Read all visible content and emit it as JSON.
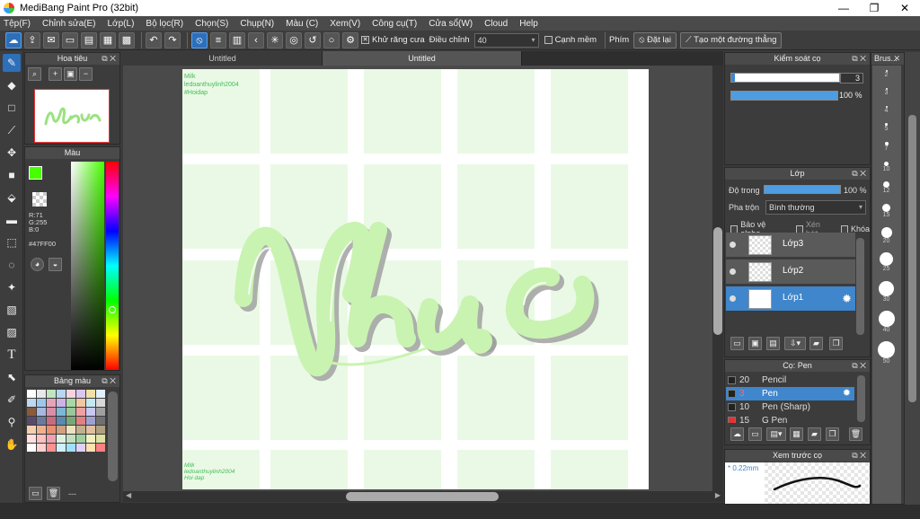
{
  "window": {
    "title": "MediBang Paint Pro (32bit)",
    "controls": [
      "—",
      "❐",
      "✕"
    ]
  },
  "menu": [
    "Tệp(F)",
    "Chỉnh sửa(E)",
    "Lớp(L)",
    "Bộ lọc(R)",
    "Chọn(S)",
    "Chụp(N)",
    "Màu (C)",
    "Xem(V)",
    "Công cụ(T)",
    "Cửa sổ(W)",
    "Cloud",
    "Help"
  ],
  "toolbar": {
    "antialias_label": "Khử răng cưa",
    "adjust_label": "Điều chỉnh",
    "adjust_value": "40",
    "edge_label": "Cạnh mềm",
    "key_label": "Phím",
    "reset_label": "Đặt lại",
    "line_label": "Tạo một đường thẳng"
  },
  "navigator": {
    "title": "Hoa tiêu"
  },
  "color": {
    "title": "Màu",
    "rgb": [
      "R:71",
      "G:255",
      "B:0"
    ],
    "hex": "#47FF00",
    "primary": "#47ff00",
    "secondary": "#ffffff"
  },
  "palette": {
    "title": "Bảng màu",
    "footer": "---"
  },
  "tabs": [
    "Untitled",
    "Untitled"
  ],
  "canvas": {
    "top_text": [
      "Milk",
      "ledoanthuylinh2004",
      "#Hoidap"
    ],
    "artwork": "Nhục",
    "bottom_text": [
      "Milk",
      "ledoanthuylinh2004",
      "Hoi dap"
    ],
    "art_color": "#c9f3b1",
    "shadow_color": "#9c9c9c"
  },
  "brush_control": {
    "title": "Kiểm soát cọ",
    "size": "3",
    "opacity": "100 %"
  },
  "layers": {
    "title": "Lớp",
    "opacity_label": "Độ trong",
    "opacity_value": "100 %",
    "blend_label": "Pha trộn",
    "blend_value": "Bình thường",
    "protect_alpha": "Bảo vệ alpha",
    "clipping": "Xén bớt",
    "lock": "Khóa",
    "items": [
      {
        "name": "Lớp3",
        "selected": false
      },
      {
        "name": "Lớp2",
        "selected": false
      },
      {
        "name": "Lớp1",
        "selected": true
      }
    ]
  },
  "brushes": {
    "title": "Cọ: Pen",
    "items": [
      {
        "size": "20",
        "name": "Pencil",
        "color": "#222222",
        "selected": false
      },
      {
        "size": "3",
        "name": "Pen",
        "color": "#222222",
        "selected": true
      },
      {
        "size": "10",
        "name": "Pen (Sharp)",
        "color": "#222222",
        "selected": false
      },
      {
        "size": "15",
        "name": "G Pen",
        "color": "#e33333",
        "selected": false
      }
    ]
  },
  "preview": {
    "title": "Xem trước cọ",
    "size": "* 0.22mm"
  },
  "brush_sizes": {
    "title": "Brus...",
    "items": [
      "2",
      "3",
      "4",
      "5",
      "7",
      "10",
      "12",
      "15",
      "20",
      "25",
      "30",
      "40",
      "50"
    ]
  }
}
